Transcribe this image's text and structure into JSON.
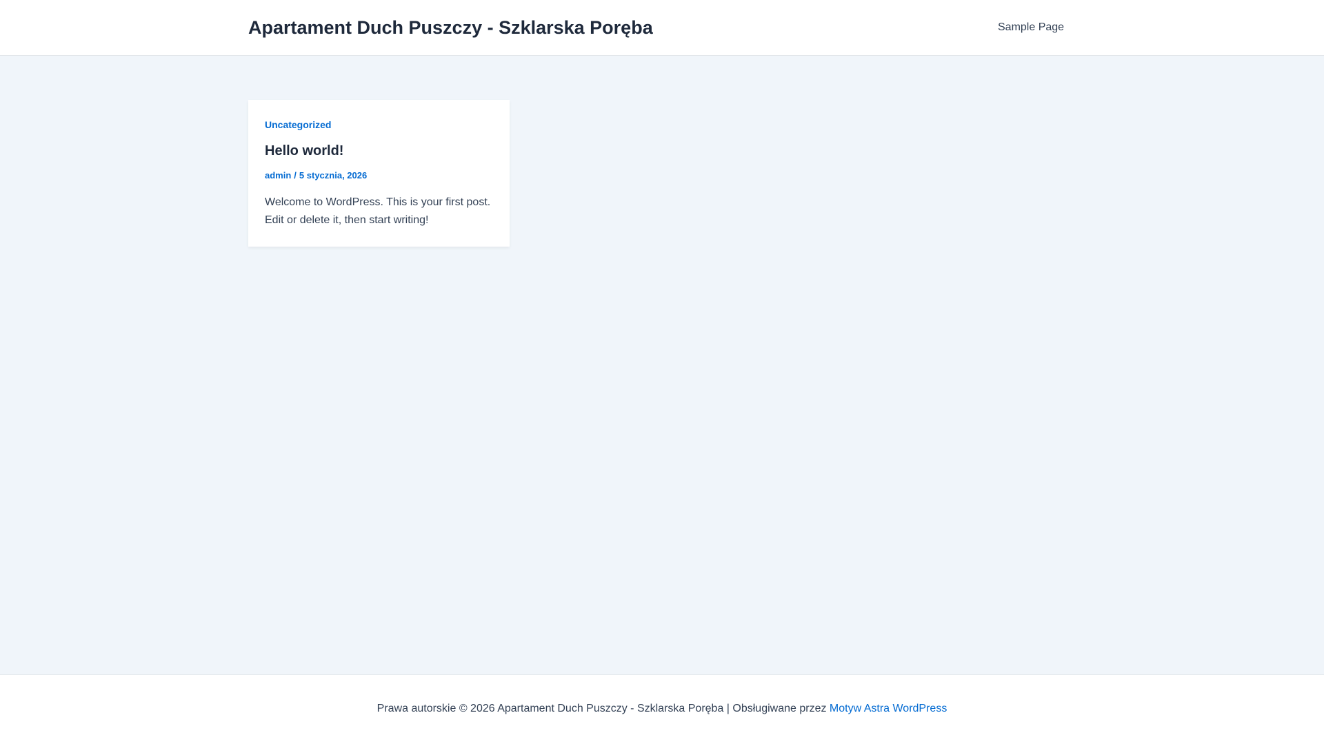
{
  "header": {
    "site_title": "Apartament Duch Puszczy - Szklarska Poręba",
    "nav": {
      "sample_page": "Sample Page"
    }
  },
  "post": {
    "category": "Uncategorized",
    "title": "Hello world!",
    "author": "admin",
    "meta_separator": "/",
    "date": "5 stycznia, 2026",
    "excerpt": "Welcome to WordPress. This is your first post. Edit or delete it, then start writing!"
  },
  "footer": {
    "copyright_text": "Prawa autorskie © 2026 Apartament Duch Puszczy - Szklarska Poręba | Obsługiwane przez ",
    "theme_link": "Motyw Astra WordPress"
  },
  "colors": {
    "background": "#f0f5fa",
    "surface": "#ffffff",
    "accent": "#046bd2",
    "heading": "#1e293b",
    "text": "#334155"
  }
}
